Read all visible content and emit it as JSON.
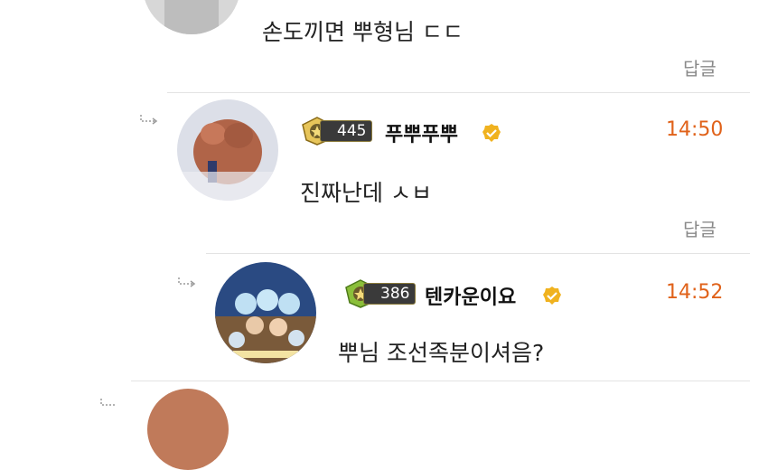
{
  "comments": [
    {
      "message": "손도끼면 뿌형님 ㄷㄷ",
      "reply_label": "답글"
    },
    {
      "level": "445",
      "username": "푸뿌푸뿌",
      "time": "14:50",
      "message": "진짜난데 ㅅㅂ",
      "reply_label": "답글"
    },
    {
      "level": "386",
      "username": "텐카운이요",
      "time": "14:52",
      "message": "뿌님 조선족분이셔음?"
    }
  ],
  "icons": {
    "reply_arrow": "reply-arrow-icon",
    "level_badge": "rank-badge-icon",
    "verified": "verified-check-icon"
  },
  "colors": {
    "time": "#e0621a",
    "verified": "#f0b21f",
    "badge_green": "#8bbf3a"
  }
}
